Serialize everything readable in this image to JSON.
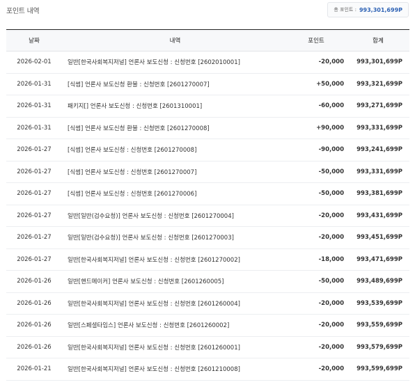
{
  "page": {
    "title": "포인트 내역",
    "total_label": "총 포인트 :",
    "total_value": "993,301,699P"
  },
  "table": {
    "headers": {
      "date": "날짜",
      "desc": "내역",
      "point": "포인트",
      "total": "합계"
    },
    "rows": [
      {
        "date": "2026-02-01",
        "desc": "일반[한국사회복지저널] 언론사 보도신청 : 신청번호 [2602010001]",
        "point": "-20,000",
        "total": "993,301,699P"
      },
      {
        "date": "2026-01-31",
        "desc": "[식썸] 언론사 보도신청 환불 : 신청번호 [2601270007]",
        "point": "+50,000",
        "total": "993,321,699P"
      },
      {
        "date": "2026-01-31",
        "desc": "패키지[] 언론사 보도신청 : 신청번호 [2601310001]",
        "point": "-60,000",
        "total": "993,271,699P"
      },
      {
        "date": "2026-01-31",
        "desc": "[식썸] 언론사 보도신청 환불 : 신청번호 [2601270008]",
        "point": "+90,000",
        "total": "993,331,699P"
      },
      {
        "date": "2026-01-27",
        "desc": "[식썸] 언론사 보도신청 : 신청번호 [2601270008]",
        "point": "-90,000",
        "total": "993,241,699P"
      },
      {
        "date": "2026-01-27",
        "desc": "[식썸] 언론사 보도신청 : 신청번호 [2601270007]",
        "point": "-50,000",
        "total": "993,331,699P"
      },
      {
        "date": "2026-01-27",
        "desc": "[식썸] 언론사 보도신청 : 신청번호 [2601270006]",
        "point": "-50,000",
        "total": "993,381,699P"
      },
      {
        "date": "2026-01-27",
        "desc": "일반[일반(검수요청)] 언론사 보도신청 : 신청번호 [2601270004]",
        "point": "-20,000",
        "total": "993,431,699P"
      },
      {
        "date": "2026-01-27",
        "desc": "일반[일반(검수요청)] 언론사 보도신청 : 신청번호 [2601270003]",
        "point": "-20,000",
        "total": "993,451,699P"
      },
      {
        "date": "2026-01-27",
        "desc": "일반[한국사회복지저널] 언론사 보도신청 : 신청번호 [2601270002]",
        "point": "-18,000",
        "total": "993,471,699P"
      },
      {
        "date": "2026-01-26",
        "desc": "일반[핸드메이커] 언론사 보도신청 : 신청번호 [2601260005]",
        "point": "-50,000",
        "total": "993,489,699P"
      },
      {
        "date": "2026-01-26",
        "desc": "일반[한국사회복지저널] 언론사 보도신청 : 신청번호 [2601260004]",
        "point": "-20,000",
        "total": "993,539,699P"
      },
      {
        "date": "2026-01-26",
        "desc": "일반[스페셜타임스] 언론사 보도신청 : 신청번호 [2601260002]",
        "point": "-20,000",
        "total": "993,559,699P"
      },
      {
        "date": "2026-01-26",
        "desc": "일반[한국사회복지저널] 언론사 보도신청 : 신청번호 [2601260001]",
        "point": "-20,000",
        "total": "993,579,699P"
      },
      {
        "date": "2026-01-21",
        "desc": "일반[한국사회복지저널] 언론사 보도신청 : 신청번호 [2601210008]",
        "point": "-20,000",
        "total": "993,599,699P"
      }
    ]
  },
  "colors": {
    "accent": "#2f63b5",
    "header_border": "#222222",
    "header_bg": "#f7f8fa"
  }
}
